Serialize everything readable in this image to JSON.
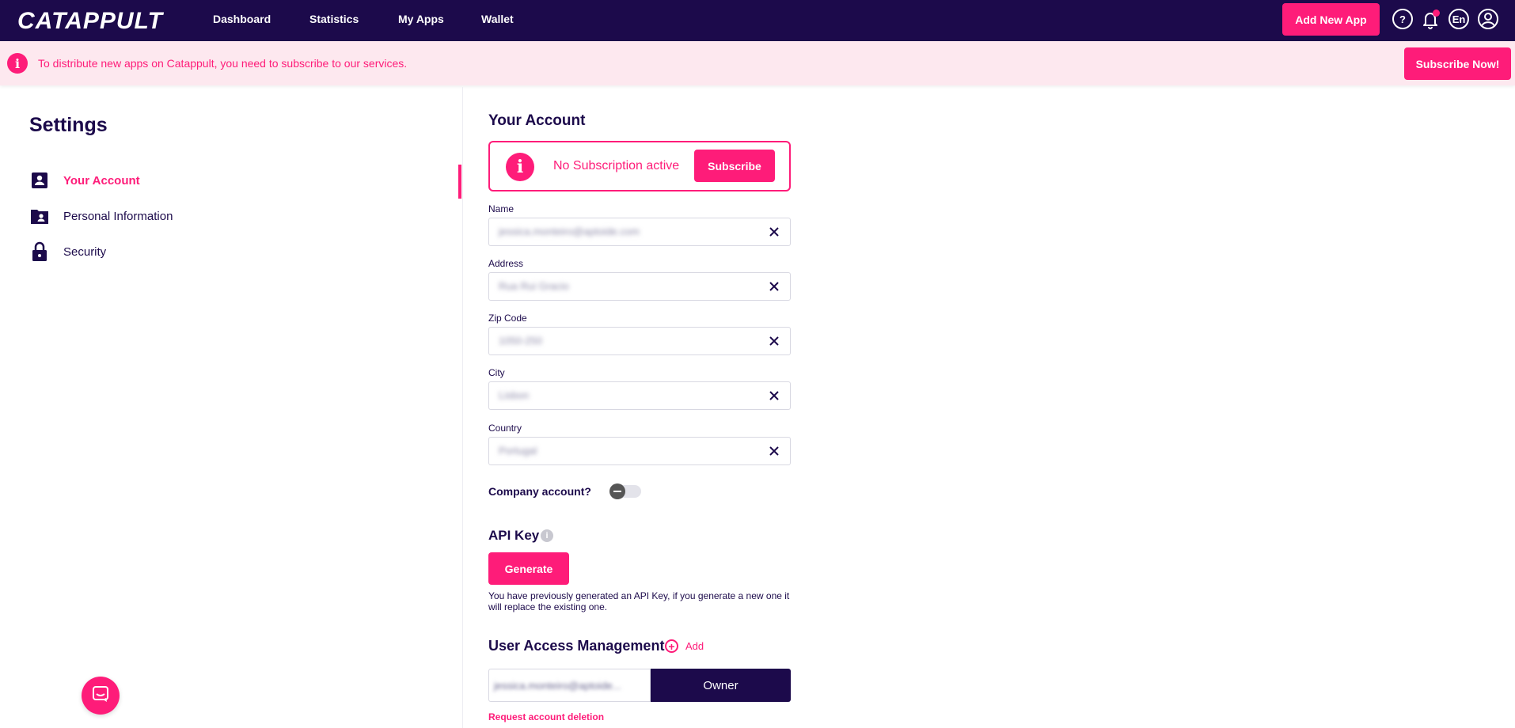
{
  "header": {
    "logo": "CATAPPULT",
    "nav": [
      "Dashboard",
      "Statistics",
      "My Apps",
      "Wallet"
    ],
    "add_app_label": "Add New App",
    "help_icon": "question-icon",
    "bell_icon": "bell-icon",
    "language": "En",
    "profile_icon": "user-circle-icon"
  },
  "banner": {
    "text": "To distribute new apps on Catappult, you need to subscribe to our services.",
    "button": "Subscribe Now!"
  },
  "sidebar": {
    "title": "Settings",
    "items": [
      {
        "label": "Your Account",
        "icon": "account-badge-icon"
      },
      {
        "label": "Personal Information",
        "icon": "folder-user-icon"
      },
      {
        "label": "Security",
        "icon": "lock-icon"
      }
    ]
  },
  "account": {
    "title": "Your Account",
    "subscription_status": "No Subscription active",
    "subscribe_label": "Subscribe",
    "fields": [
      {
        "label": "Name",
        "value": "jessica.monteiro@aptoide.com"
      },
      {
        "label": "Address",
        "value": "Rua Rui Gracio"
      },
      {
        "label": "Zip Code",
        "value": "1050-250"
      },
      {
        "label": "City",
        "value": "Lisbon"
      },
      {
        "label": "Country",
        "value": "Portugal"
      }
    ],
    "company_label": "Company account?",
    "company_account": false
  },
  "api": {
    "title": "API Key",
    "generate_label": "Generate",
    "note": "You have previously generated an API Key, if you generate a new one it will replace the existing one."
  },
  "user_access": {
    "title": "User Access Management",
    "add_label": "Add",
    "user_value": "jessica.monteiro@aptoide...",
    "role": "Owner"
  },
  "delete_label": "Request account deletion",
  "colors": {
    "brand_dark": "#1c0a4b",
    "accent": "#fe1c79"
  }
}
